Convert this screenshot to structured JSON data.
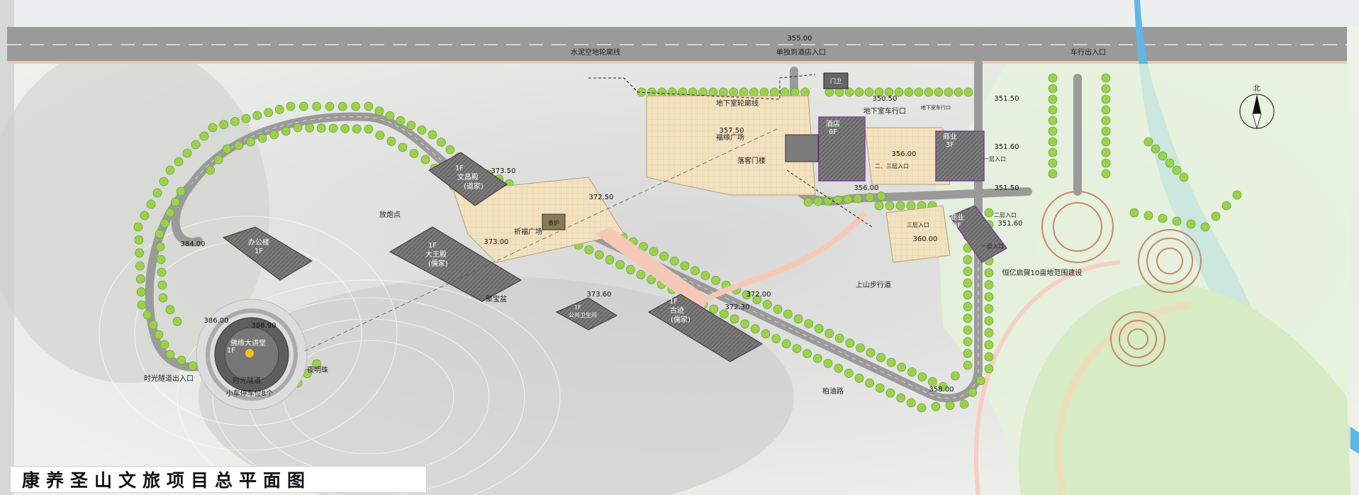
{
  "title": "康养圣山文旅项目总平面图",
  "north": "北",
  "road_labels": {
    "elevation_top": "355.00",
    "cement_slope": "水泥空地轮廓线",
    "hotel_entrance": "单独到酒店入口",
    "car_entrance": "车行出入口",
    "underground_outline": "地下室轮廓线",
    "underground_car": "地下室车行口",
    "underground_car_small": "地下室车行口",
    "uphill_path": "上山步行道",
    "asphalt_road": "柏油路",
    "firework_point": "放炮点",
    "tunnel_exit": "时光隧道出入口",
    "tunnel": "时光隧道",
    "parking": "小车停车位8个",
    "night_pearl": "夜明珠",
    "scenic_project": "恒亿启賀10亩地范围建设"
  },
  "plazas": {
    "fortune_plaza": "福缘广场",
    "pray_plaza": "祈福广场",
    "incense": "香炉",
    "jubao": "聚宝盆",
    "guest_gate": "落客门楼"
  },
  "buildings": {
    "hall_1f": "1F",
    "hall_name": "文昌殿",
    "hall_sub": "(道家)",
    "office": "办公楼",
    "office_floor": "1F",
    "main_hall_floor": "1F",
    "main_hall_name": "大王殿",
    "main_hall_sub": "(儒家)",
    "toilet_floor": "1F",
    "toilet_name": "公共卫生间",
    "gallery_floor": "1F",
    "gallery_name": "古迹",
    "gallery_sub": "(儒家)",
    "buddha": "佛缘大讲堂",
    "buddha_floor": "1F",
    "hotel_name": "酒店",
    "hotel_floor": "6F",
    "commerce_a": "商业",
    "commerce_a_floor": "3F",
    "commerce_b": "商业",
    "commerce_b_floor": "3F",
    "gate_room": "门卫",
    "entry_23": "二、三层入口",
    "entry_1": "一层入口",
    "entry_2": "二层入口",
    "entry_3": "三层入口",
    "entry_1b": "一层入口"
  },
  "elevations": {
    "e1": "357.50",
    "e2": "350.50",
    "e3": "351.50",
    "e4": "351.60",
    "e5": "356.00",
    "e6": "356.00",
    "e7": "351.50",
    "e8": "360.00",
    "e9": "351.60",
    "e10": "373.50",
    "e11": "372.50",
    "e12": "373.00",
    "e13": "384.00",
    "e14": "373.60",
    "e15": "372.00",
    "e16": "372.30",
    "e17": "386.00",
    "e18": "388.90",
    "e19": "358.00"
  },
  "colors": {
    "road": "#9a9a9a",
    "river": "#5fb7e6",
    "tree": "#9ad14e",
    "plaza": "#f4e3c1",
    "building": "#6b6b6b",
    "path": "#f5c9b6"
  }
}
